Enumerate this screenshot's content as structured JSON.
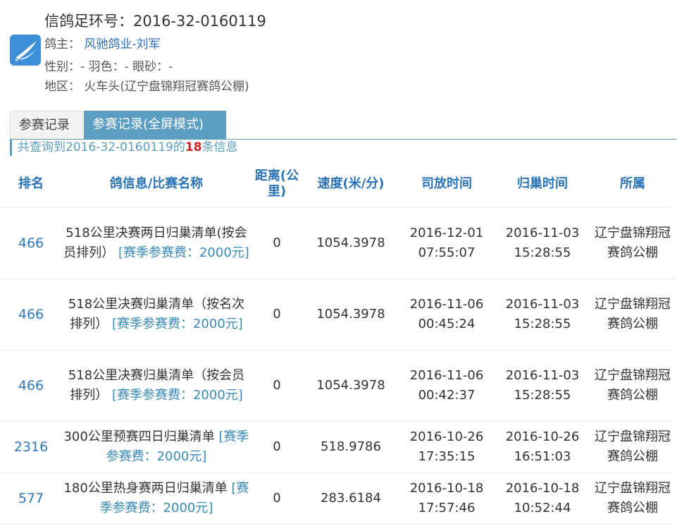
{
  "header": {
    "ring_label": "信鸽足环号：",
    "ring_no": "2016-32-0160119",
    "owner_label": "鸽主：",
    "owner": "风驰鸽业-刘军",
    "attrs": "性别：- 羽色：- 眼砂：-",
    "region_label": "地区：",
    "region": "火车头(辽宁盘锦翔冠赛鸽公棚)"
  },
  "tabs": [
    {
      "label": "参赛记录",
      "active": false
    },
    {
      "label": "参赛记录(全屏模式)",
      "active": true
    }
  ],
  "summary": {
    "prefix": "共查询到2016-32-0160119的",
    "count": "18",
    "suffix": "条信息"
  },
  "table": {
    "headers": {
      "rank": "排名",
      "race": "鸽信息/比赛名称",
      "distance": "距离(公里)",
      "speed": "速度(米/分)",
      "release": "司放时间",
      "return": "归巢时间",
      "club": "所属"
    },
    "rows": [
      {
        "rank": "466",
        "race": "518公里决赛两日归巢清单(按会员排列）",
        "fee": "[赛季参赛费：2000元]",
        "distance": "0",
        "speed": "1054.3978",
        "release": "2016-12-01 07:55:07",
        "return": "2016-11-03 15:28:55",
        "club": "辽宁盘锦翔冠赛鸽公棚"
      },
      {
        "rank": "466",
        "race": "518公里决赛归巢清单（按名次排列）",
        "fee": "[赛季参赛费：2000元]",
        "distance": "0",
        "speed": "1054.3978",
        "release": "2016-11-06 00:45:24",
        "return": "2016-11-03 15:28:55",
        "club": "辽宁盘锦翔冠赛鸽公棚"
      },
      {
        "rank": "466",
        "race": "518公里决赛归巢清单（按会员排列）",
        "fee": "[赛季参赛费：2000元]",
        "distance": "0",
        "speed": "1054.3978",
        "release": "2016-11-06 00:42:37",
        "return": "2016-11-03 15:28:55",
        "club": "辽宁盘锦翔冠赛鸽公棚"
      },
      {
        "rank": "2316",
        "race": "300公里预赛四日归巢清单",
        "fee": "[赛季参赛费：2000元]",
        "distance": "0",
        "speed": "518.9786",
        "release": "2016-10-26 17:35:15",
        "return": "2016-10-26 16:51:03",
        "club": "辽宁盘锦翔冠赛鸽公棚"
      },
      {
        "rank": "577",
        "race": "180公里热身赛两日归巢清单",
        "fee": "[赛季参赛费：2000元]",
        "distance": "0",
        "speed": "283.6184",
        "release": "2016-10-18 17:57:46",
        "return": "2016-10-18 10:52:44",
        "club": "辽宁盘锦翔冠赛鸽公棚"
      }
    ]
  },
  "icons": {
    "logo": "pigeon-wing-logo-icon"
  },
  "colors": {
    "accent": "#5b9ec2",
    "header_text": "#2a73b6",
    "count_red": "#d42020",
    "logo_blue": "#3d8fd8"
  }
}
